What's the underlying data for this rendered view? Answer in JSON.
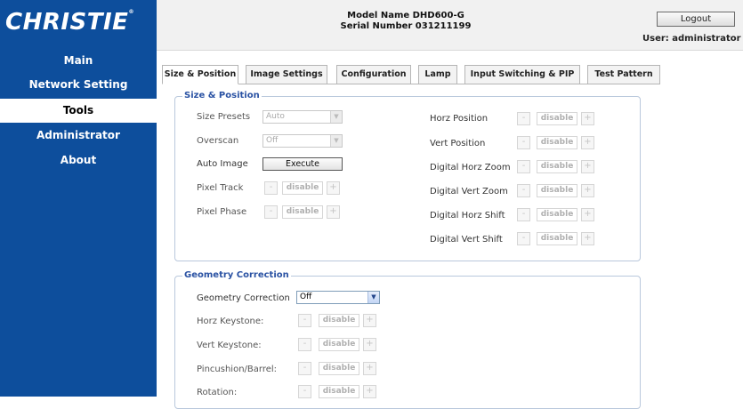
{
  "brand": {
    "logo_text": "CHRISTIE",
    "logo_mark": "®"
  },
  "nav": {
    "items": [
      {
        "label": "Main"
      },
      {
        "label": "Network Setting"
      },
      {
        "label": "Tools"
      },
      {
        "label": "Administrator"
      },
      {
        "label": "About"
      }
    ],
    "active": "Tools"
  },
  "header": {
    "model_line": "Model Name DHD600-G",
    "serial_line": "Serial Number 031211199",
    "logout_label": "Logout",
    "user_label": "User: administrator"
  },
  "tabs": [
    {
      "label": "Size & Position",
      "active": true
    },
    {
      "label": "Image Settings",
      "active": false
    },
    {
      "label": "Configuration",
      "active": false
    },
    {
      "label": "Lamp",
      "active": false
    },
    {
      "label": "Input Switching & PIP",
      "active": false
    },
    {
      "label": "Test Pattern",
      "active": false
    }
  ],
  "size_position": {
    "legend": "Size & Position",
    "left": {
      "size_presets": {
        "label": "Size Presets",
        "value": "Auto"
      },
      "overscan": {
        "label": "Overscan",
        "value": "Off"
      },
      "auto_image": {
        "label": "Auto Image",
        "button": "Execute"
      },
      "pixel_track": {
        "label": "Pixel Track"
      },
      "pixel_phase": {
        "label": "Pixel Phase"
      }
    },
    "right": [
      {
        "label": "Horz Position"
      },
      {
        "label": "Vert Position"
      },
      {
        "label": "Digital Horz Zoom"
      },
      {
        "label": "Digital Vert Zoom"
      },
      {
        "label": "Digital Horz Shift"
      },
      {
        "label": "Digital Vert Shift"
      }
    ]
  },
  "geometry": {
    "legend": "Geometry Correction",
    "mode": {
      "label": "Geometry Correction",
      "value": "Off"
    },
    "rows": [
      {
        "label": "Horz Keystone:"
      },
      {
        "label": "Vert Keystone:"
      },
      {
        "label": "Pincushion/Barrel:"
      },
      {
        "label": "Rotation:"
      }
    ]
  },
  "stepper": {
    "minus": "-",
    "plus": "+",
    "value": "disable"
  },
  "colors": {
    "nav_blue": "#0d4e9c",
    "legend_blue": "#2a52a3",
    "header_bg": "#f1f1f1"
  }
}
